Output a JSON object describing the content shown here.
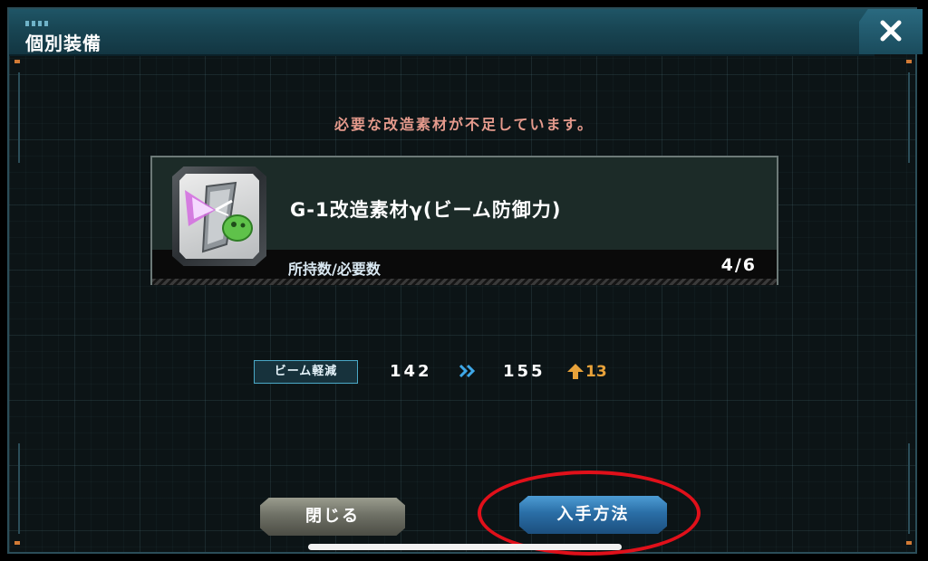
{
  "dialog": {
    "title": "個別装備",
    "close_icon": "close-x-icon"
  },
  "message": "必要な改造素材が不足しています。",
  "material": {
    "icon": "beam-defense-material-icon",
    "name": "G-1改造素材γ(ビーム防御力)",
    "owned_label": "所持数/必要数",
    "owned_count": "4/6",
    "owned": 4,
    "required": 6
  },
  "stat": {
    "label": "ビーム軽減",
    "before": "142",
    "after": "155",
    "increase": "13",
    "arrow_icon": "double-chevron-right-icon",
    "up_icon": "up-arrow-icon"
  },
  "buttons": {
    "close_label": "閉じる",
    "obtain_label": "入手方法"
  },
  "colors": {
    "header": "#184553",
    "accent_blue": "#2a6ea6",
    "warning_text": "#e59a8c",
    "increase_orange": "#e8a23a",
    "highlight_red": "#e0101a"
  }
}
